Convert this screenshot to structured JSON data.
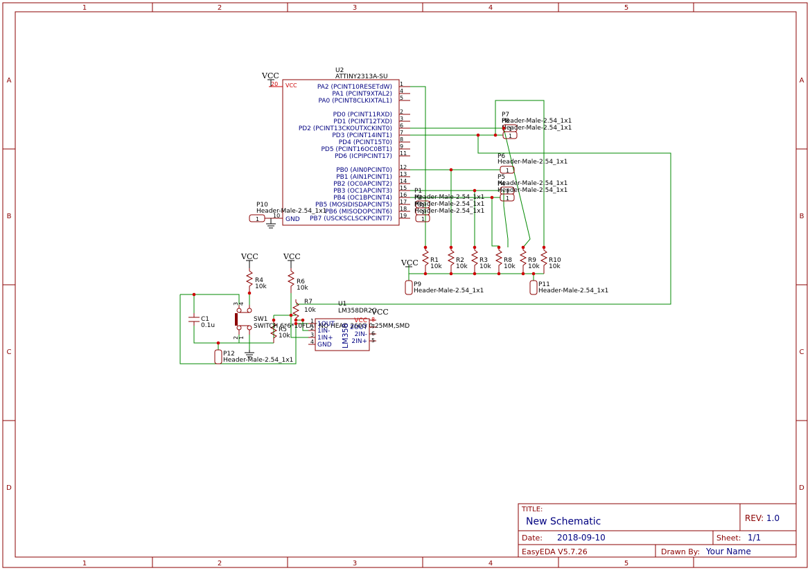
{
  "colors": {
    "frame": "#8b0000",
    "wire": "#008800",
    "pin_text": "#000080",
    "ref": "#000000",
    "pin_num": "#8b0000",
    "junction": "#cc0000"
  },
  "frame": {
    "cols": [
      "1",
      "2",
      "3",
      "4",
      "5"
    ],
    "rows": [
      "A",
      "B",
      "C",
      "D"
    ]
  },
  "title_block": {
    "title_label": "TITLE:",
    "title": "New Schematic",
    "rev_label": "REV:",
    "rev": "1.0",
    "date_label": "Date:",
    "date": "2018-09-10",
    "sheet_label": "Sheet:",
    "sheet": "1/1",
    "tool": "EasyEDA V5.7.26",
    "drawn_label": "Drawn By:",
    "drawn_by": "Your Name"
  },
  "u2": {
    "ref": "U2",
    "value": "ATTINY2313A-SU",
    "vcc_label": "VCC",
    "gnd_label": "GND",
    "vcc_pin": "20",
    "gnd_pin": "10",
    "pins": [
      {
        "name": "PA2 (PCINT10RESETdW)",
        "num": "1"
      },
      {
        "name": "PA1 (PCINT9XTAL2)",
        "num": "4"
      },
      {
        "name": "PA0 (PCINT8CLKIXTAL1)",
        "num": "5"
      },
      {
        "name": "PD0 (PCINT11RXD)",
        "num": "2"
      },
      {
        "name": "PD1 (PCINT12TXD)",
        "num": "3"
      },
      {
        "name": "PD2 (PCINT13CKOUTXCKINT0)",
        "num": "6"
      },
      {
        "name": "PD3 (PCINT14INT1)",
        "num": "7"
      },
      {
        "name": "PD4 (PCINT15T0)",
        "num": "8"
      },
      {
        "name": "PD5 (PCINT16OC0BT1)",
        "num": "9"
      },
      {
        "name": "PD6 (ICPIPCINT17)",
        "num": "11"
      },
      {
        "name": "PB0 (AIN0PCINT0)",
        "num": "12"
      },
      {
        "name": "PB1 (AIN1PCINT1)",
        "num": "13"
      },
      {
        "name": "PB2 (OC0APCINT2)",
        "num": "14"
      },
      {
        "name": "PB3 (OC1APCINT3)",
        "num": "15"
      },
      {
        "name": "PB4 (OC1BPCINT4)",
        "num": "16"
      },
      {
        "name": "PB5 (MOSIDISDAPCINT5)",
        "num": "17"
      },
      {
        "name": "PB6 (MISODOPCINT6)",
        "num": "18"
      },
      {
        "name": "PB7 (USCKSCLSCKPCINT7)",
        "num": "19"
      }
    ]
  },
  "u1": {
    "ref": "U1",
    "value": "LM358DR2G",
    "body_text": "LM358",
    "vcc_label": "VCC",
    "gnd_label": "GND",
    "pins_left": [
      {
        "name": "1OUT",
        "num": "1"
      },
      {
        "name": "1IN-",
        "num": "2"
      },
      {
        "name": "1IN+",
        "num": "3"
      },
      {
        "name": "GND",
        "num": "4"
      }
    ],
    "pins_right": [
      {
        "name": "VCC",
        "num": "8"
      },
      {
        "name": "2OUT",
        "num": "7"
      },
      {
        "name": "2IN-",
        "num": "6"
      },
      {
        "name": "2IN+",
        "num": "5"
      }
    ]
  },
  "resistors_top": [
    {
      "ref": "R1",
      "value": "10k"
    },
    {
      "ref": "R2",
      "value": "10k"
    },
    {
      "ref": "R3",
      "value": "10k"
    },
    {
      "ref": "R8",
      "value": "10k"
    },
    {
      "ref": "R9",
      "value": "10k"
    },
    {
      "ref": "R10",
      "value": "10k"
    }
  ],
  "resistors_bottom": [
    {
      "ref": "R4",
      "value": "10k"
    },
    {
      "ref": "R6",
      "value": "10k"
    },
    {
      "ref": "R7",
      "value": "10k"
    },
    {
      "ref": "R5",
      "value": "10k"
    }
  ],
  "headers": [
    {
      "ref": "P1",
      "value": "Header-Male-2.54_1x1",
      "pin": "1"
    },
    {
      "ref": "P2",
      "value": "Header-Male-2.54_1x1",
      "pin": "1"
    },
    {
      "ref": "P3",
      "value": "Header-Male-2.54_1x1",
      "pin": "1"
    },
    {
      "ref": "P4",
      "value": "Header-Male-2.54_1x1",
      "pin": "1"
    },
    {
      "ref": "P5",
      "value": "Header-Male-2.54_1x1",
      "pin": "1"
    },
    {
      "ref": "P6",
      "value": "Header-Male-2.54_1x1",
      "pin": "1"
    },
    {
      "ref": "P7",
      "value": "Header-Male-2.54_1x1",
      "pin": "1"
    },
    {
      "ref": "P8",
      "value": "Header-Male-2.54_1x1",
      "pin": "1"
    },
    {
      "ref": "P9",
      "value": "Header-Male-2.54_1x1",
      "pin": "1"
    },
    {
      "ref": "P10",
      "value": "Header-Male-2.54_1x1",
      "pin": "1"
    },
    {
      "ref": "P11",
      "value": "Header-Male-2.54_1x1",
      "pin": "1"
    },
    {
      "ref": "P12",
      "value": "Header-Male-2.54_1x1",
      "pin": "1"
    }
  ],
  "c1": {
    "ref": "C1",
    "value": "0.1u"
  },
  "sw1": {
    "ref": "SW1",
    "value": "SWITCH 6*6*10FLAT NO HEAD 260G 0.25MM,SMD",
    "pins": [
      "4",
      "3",
      "2",
      "1"
    ]
  },
  "power": {
    "vcc": "VCC"
  }
}
